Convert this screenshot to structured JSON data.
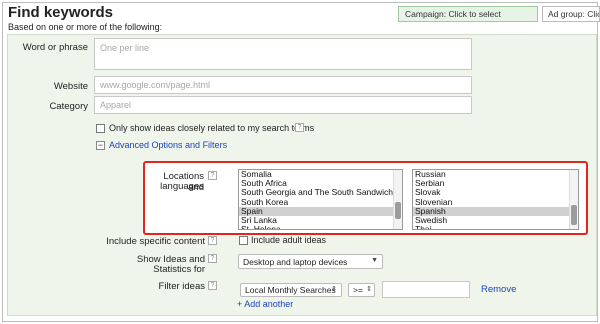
{
  "header": {
    "title": "Find keywords",
    "subtitle": "Based on one or more of the following:",
    "campaign_button": "Campaign: Click to select",
    "adgroup_button": "Ad group: Click to"
  },
  "form": {
    "word_label": "Word or phrase",
    "word_placeholder": "One per line",
    "website_label": "Website",
    "website_placeholder": "www.google.com/page.html",
    "category_label": "Category",
    "category_placeholder": "Apparel",
    "closely_related_label": "Only show ideas closely related to my search terms",
    "advanced_link": "Advanced Options and Filters",
    "advanced_toggle": "−",
    "help_glyph": "?"
  },
  "locations": {
    "label_line1": "Locations and",
    "label_line2": "languages",
    "countries": [
      {
        "name": "Somalia",
        "selected": false
      },
      {
        "name": "South Africa",
        "selected": false
      },
      {
        "name": "South Georgia and The South Sandwich Islands",
        "selected": false
      },
      {
        "name": "South Korea",
        "selected": false
      },
      {
        "name": "Spain",
        "selected": true
      },
      {
        "name": "Sri Lanka",
        "selected": false
      },
      {
        "name": "St. Helena",
        "selected": false
      }
    ],
    "languages": [
      {
        "name": "Russian",
        "selected": false
      },
      {
        "name": "Serbian",
        "selected": false
      },
      {
        "name": "Slovak",
        "selected": false
      },
      {
        "name": "Slovenian",
        "selected": false
      },
      {
        "name": "Spanish",
        "selected": true
      },
      {
        "name": "Swedish",
        "selected": false
      },
      {
        "name": "Thai",
        "selected": false
      }
    ]
  },
  "content": {
    "label": "Include specific content",
    "adult_label": "Include adult ideas"
  },
  "ideas_stats": {
    "label_line1": "Show Ideas and",
    "label_line2": "Statistics for",
    "device_value": "Desktop and laptop devices"
  },
  "filter": {
    "label": "Filter ideas",
    "metric_value": "Local Monthly Searches",
    "operator_value": ">=",
    "amount_value": "",
    "remove_link": "Remove",
    "add_link": "+ Add another"
  },
  "colors": {
    "panel_bg": "#f0f5ec",
    "highlight_border": "#e0261f",
    "link": "#1a45b8",
    "campaign_bg": "#e6f3e6"
  }
}
